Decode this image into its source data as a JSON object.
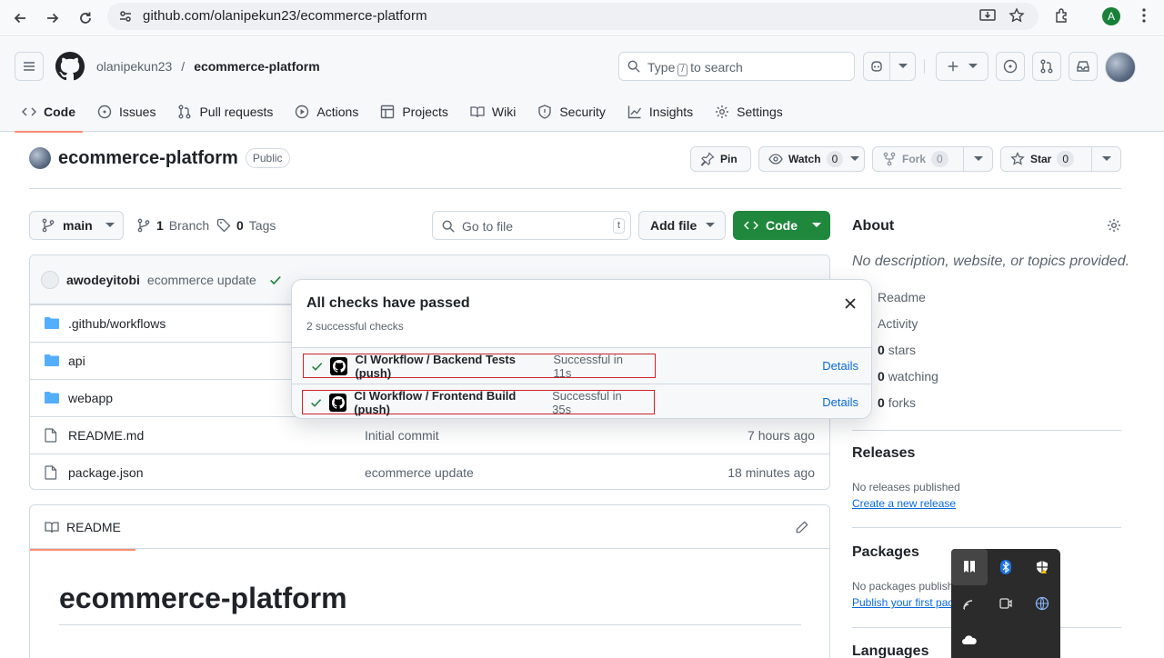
{
  "browser": {
    "url": "github.com/olanipekun23/ecommerce-platform",
    "profile_initial": "A"
  },
  "header": {
    "owner": "olanipekun23",
    "separator": "/",
    "repo": "ecommerce-platform",
    "search_before": "Type",
    "search_key": "/",
    "search_after": "to search"
  },
  "tabs": [
    {
      "label": "Code",
      "icon": "code-icon",
      "active": true
    },
    {
      "label": "Issues",
      "icon": "issue-icon"
    },
    {
      "label": "Pull requests",
      "icon": "pull-request-icon"
    },
    {
      "label": "Actions",
      "icon": "play-icon"
    },
    {
      "label": "Projects",
      "icon": "table-icon"
    },
    {
      "label": "Wiki",
      "icon": "book-icon"
    },
    {
      "label": "Security",
      "icon": "shield-icon"
    },
    {
      "label": "Insights",
      "icon": "graph-icon"
    },
    {
      "label": "Settings",
      "icon": "gear-icon"
    }
  ],
  "repo": {
    "name": "ecommerce-platform",
    "visibility": "Public",
    "pin_label": "Pin",
    "watch_label": "Watch",
    "watch_count": "0",
    "fork_label": "Fork",
    "fork_count": "0",
    "star_label": "Star",
    "star_count": "0"
  },
  "branch_bar": {
    "branch": "main",
    "branch_count": "1",
    "branch_word": "Branch",
    "tag_count": "0",
    "tag_word": "Tags",
    "goto_placeholder": "Go to file",
    "goto_key": "t",
    "add_file": "Add file",
    "code": "Code"
  },
  "commit": {
    "user": "awodeyitobi",
    "message": "ecommerce update"
  },
  "files": [
    {
      "name": ".github/workflows",
      "type": "folder",
      "message": "",
      "date": ""
    },
    {
      "name": "api",
      "type": "folder",
      "message": "",
      "date": ""
    },
    {
      "name": "webapp",
      "type": "folder",
      "message": "",
      "date": ""
    },
    {
      "name": "README.md",
      "type": "file",
      "message": "Initial commit",
      "date": "7 hours ago"
    },
    {
      "name": "package.json",
      "type": "file",
      "message": "ecommerce update",
      "date": "18 minutes ago"
    }
  ],
  "readme": {
    "tab": "README",
    "heading": "ecommerce-platform"
  },
  "sidebar": {
    "about": "About",
    "description": "No description, website, or topics provided.",
    "readme": "Readme",
    "activity": "Activity",
    "stars_count": "0",
    "stars_word": "stars",
    "watching_count": "0",
    "watching_word": "watching",
    "forks_count": "0",
    "forks_word": "forks",
    "releases": "Releases",
    "no_releases": "No releases published",
    "create_release": "Create a new release",
    "packages": "Packages",
    "no_packages": "No packages publish",
    "publish_package": "Publish your first pac",
    "languages": "Languages"
  },
  "checks": {
    "title": "All checks have passed",
    "subtitle": "2 successful checks",
    "items": [
      {
        "name": "CI Workflow / Backend Tests (push)",
        "status": "Successful in 11s",
        "details": "Details"
      },
      {
        "name": "CI Workflow / Frontend Build (push)",
        "status": "Successful in 35s",
        "details": "Details"
      }
    ]
  },
  "colors": {
    "accent_green": "#1f883d",
    "link_blue": "#0969da",
    "highlight_red": "#cf222e",
    "tab_underline": "#fd8c73"
  }
}
